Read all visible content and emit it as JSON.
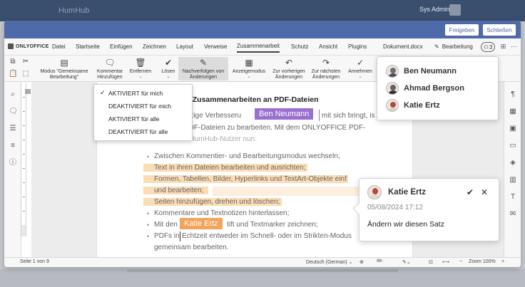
{
  "host": {
    "brand": "HumHub",
    "user": "Sys Admin"
  },
  "modal_buttons": {
    "share": "Freigeben",
    "close": "Schließen"
  },
  "menubar": {
    "brand": "ONLYOFFICE",
    "items": [
      "Datei",
      "Startseite",
      "Einfügen",
      "Zeichnen",
      "Layout",
      "Verweise",
      "Zusammenarbeit",
      "Schutz",
      "Ansicht",
      "Plugins"
    ],
    "active": "Zusammenarbeit",
    "document_name": "Dokument.docx",
    "edit_mode": "Bearbeitung",
    "user_count": "3"
  },
  "toolbar": {
    "mode_l1": "Modus \"Gemeinsame",
    "mode_l2": "Bearbeitung\"",
    "comment_l1": "Kommentar",
    "comment_l2": "Hinzufügen",
    "remove": "Entfernen",
    "resolve": "Lösen",
    "track_l1": "Nachverfolgen von",
    "track_l2": "Änderungen",
    "display": "Anzeigemodus",
    "prev_l1": "Zur vorherigen",
    "prev_l2": "Änderungen",
    "next_l1": "Zur nächsten",
    "next_l2": "Änderungen",
    "accept": "Annehmen"
  },
  "track_dropdown": {
    "items": [
      "AKTIVIERT für mich",
      "DEAKTIVIERT für mich",
      "AKTIVIERT für alle",
      "DEAKTIVIERT für alle"
    ],
    "checked_index": 0
  },
  "document": {
    "heading": "nd Zusammenarbeiten an PDF-Dateien",
    "para_l1a": "chtige Verbesseru",
    "para_l1b": "mit sich bringt, is",
    "para_l2": "PDF-Dateien zu bearbeiten. Mit dem ONLYOFFICE PDF-",
    "para_l3": "Editor können HumHub-Nutzer nun:",
    "bullets": [
      "Zwischen Kommentier- und Bearbeitungsmodus wechseln;",
      "Text in ihren Dateien bearbeiten und ausrichten;",
      "Formen, Tabellen, Bilder, Hyperlinks und TextArt-Objekte einf",
      "und bearbeiten;",
      "Seiten hinzufügen, drehen und löschen;",
      "Kommentare und Textnotizen hinterlassen;",
      "Mit den",
      "tift und Textmarker zeichnen;",
      "PDFs in",
      "Echtzeit entweder im Schnell- oder im Strikten-Modus",
      "gemeinsam bearbeiten."
    ]
  },
  "cursors": {
    "ben": "Ben Neumann",
    "katie": "Katie Ertz"
  },
  "users_panel": {
    "users": [
      "Ben Neumann",
      "Ahmad Bergson",
      "Katie Ertz"
    ]
  },
  "comment": {
    "author": "Katie Ertz",
    "date": "05/08/2024 17:12",
    "text": "Ändern wir diesen Satz"
  },
  "statusbar": {
    "page": "Seite 1 von 9",
    "language": "Deutsch (German)",
    "zoom": "Zoom 100%"
  },
  "colors": {
    "accent": "#4f6aa8",
    "ben_cursor": "#9b6fd0",
    "katie_cursor": "#f4a35a",
    "highlight": "#fbdcb5"
  }
}
